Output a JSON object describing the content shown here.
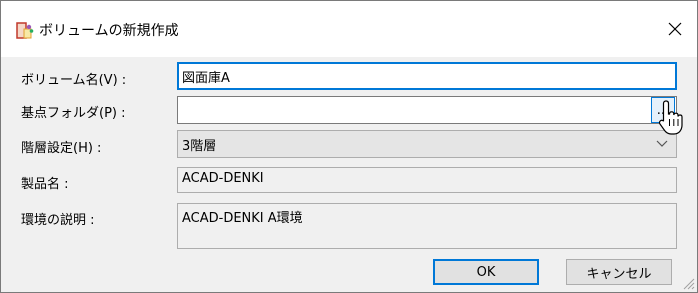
{
  "window": {
    "title": "ボリュームの新規作成",
    "app_icon": "app-icon",
    "close_icon": "close-icon"
  },
  "form": {
    "volume_name": {
      "label": "ボリューム名(V) :",
      "value": "図面庫A"
    },
    "base_folder": {
      "label": "基点フォルダ(P) :",
      "value": "",
      "browse_label": "..."
    },
    "hierarchy": {
      "label": "階層設定(H) :",
      "value": "3階層"
    },
    "product_name": {
      "label": "製品名 :",
      "value": "ACAD-DENKI"
    },
    "env_description": {
      "label": "環境の説明 :",
      "value": "ACAD-DENKI A環境"
    }
  },
  "buttons": {
    "ok": "OK",
    "cancel": "キャンセル"
  },
  "colors": {
    "accent": "#0078d7",
    "dialog_bg": "#f0f0f0"
  }
}
